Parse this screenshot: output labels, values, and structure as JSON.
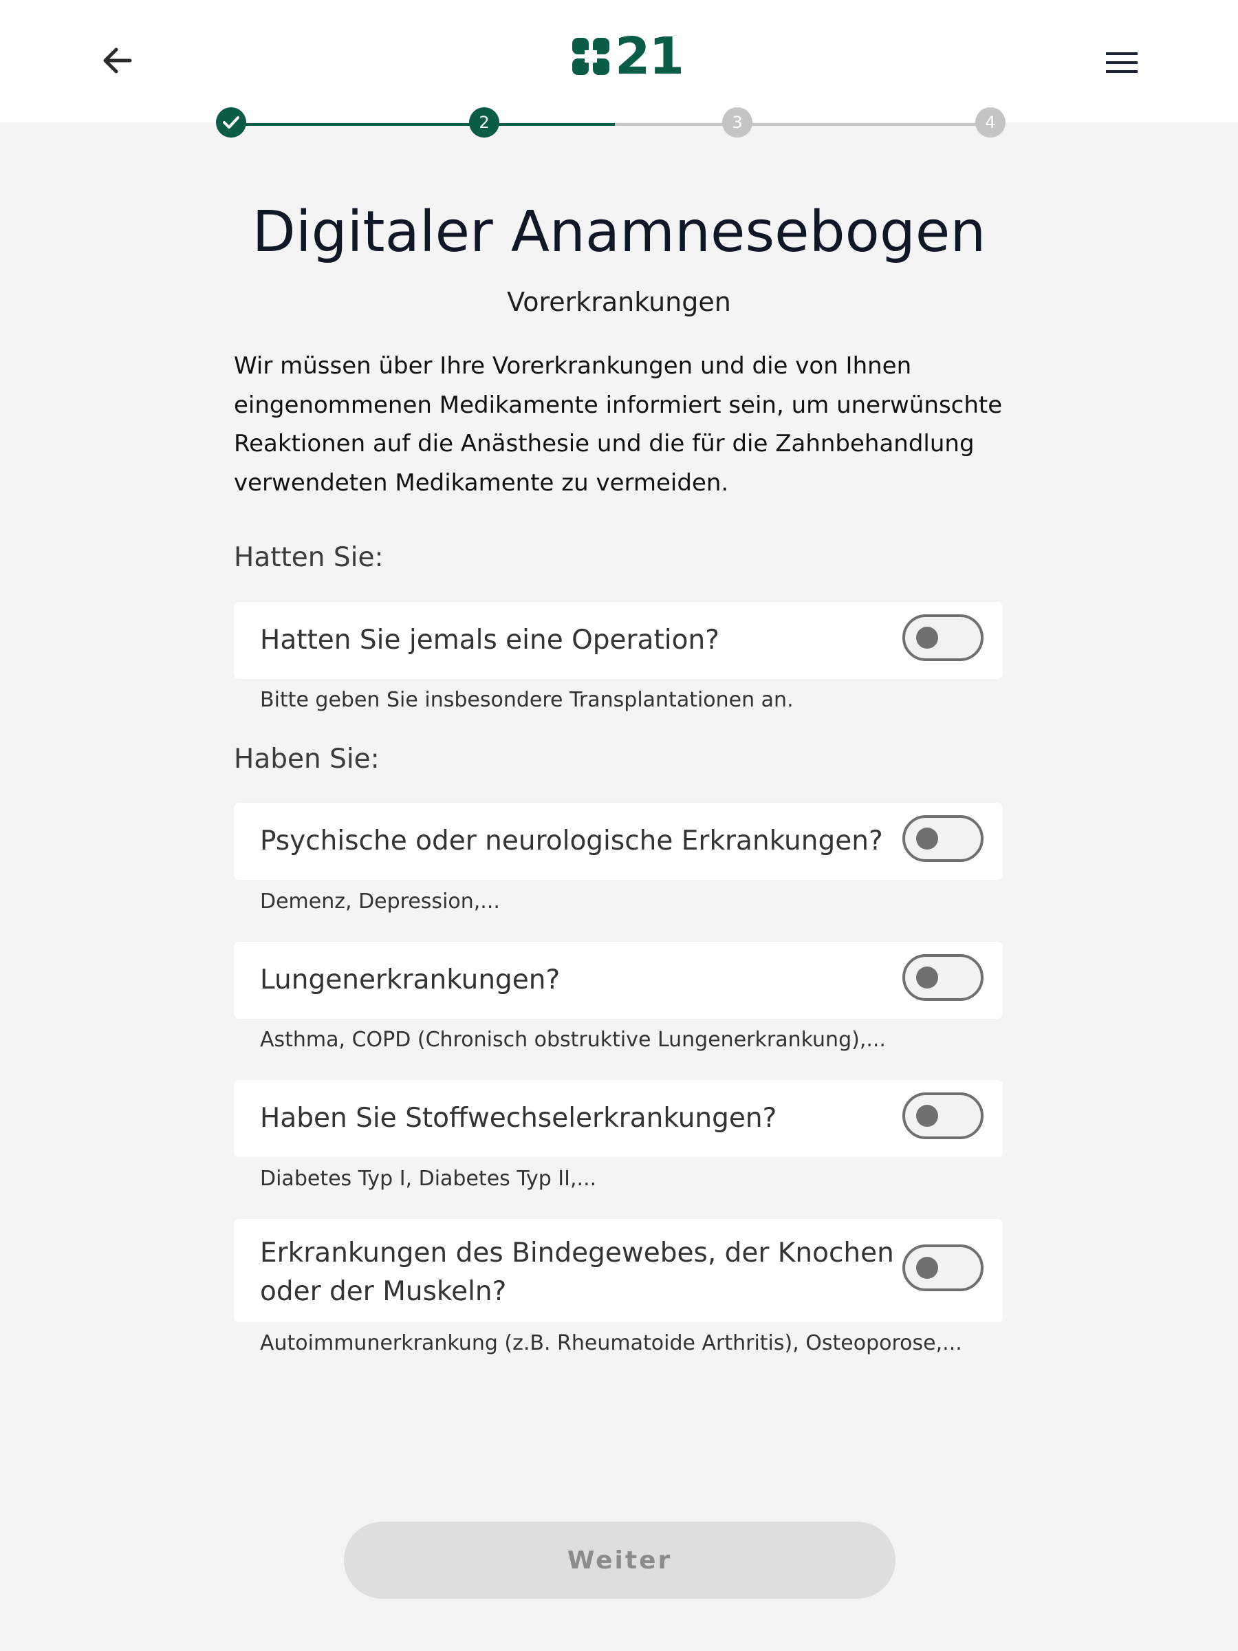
{
  "header": {
    "back_icon": "arrow-left-icon",
    "logo_text": "21",
    "logo_icon": "clover-dots-icon",
    "menu_icon": "hamburger-menu-icon",
    "brand_color": "#0b5c46"
  },
  "stepper": {
    "steps": [
      {
        "label": "",
        "state": "done"
      },
      {
        "label": "2",
        "state": "current"
      },
      {
        "label": "3",
        "state": "todo"
      },
      {
        "label": "4",
        "state": "todo"
      }
    ]
  },
  "main": {
    "title": "Digitaler Anamnesebogen",
    "subtitle": "Vorerkrankungen",
    "intro_lines": [
      "Wir müssen über Ihre Vorerkrankungen und die von Ihnen",
      "eingenommenen Medikamente informiert sein, um unerwünschte",
      "Reaktionen auf die Anästhesie und die für die Zahnbehandlung",
      "verwendeten Medikamente zu vermeiden."
    ],
    "section_had": "Hatten Sie:",
    "section_have": "Haben Sie:",
    "questions": [
      {
        "label": "Hatten Sie jemals eine Operation?",
        "hint": "Bitte geben Sie insbesondere Transplantationen an.",
        "checked": false
      },
      {
        "label": "Psychische oder neurologische Erkrankungen?",
        "hint": "Demenz, Depression,...",
        "checked": false
      },
      {
        "label": "Lungenerkrankungen?",
        "hint": "Asthma, COPD (Chronisch obstruktive Lungenerkrankung),...",
        "checked": false
      },
      {
        "label": "Haben Sie Stoffwechselerkrankungen?",
        "hint": "Diabetes Typ I, Diabetes Typ II,...",
        "checked": false
      },
      {
        "label_lines": [
          "Erkrankungen des Bindegewebes, der Knochen",
          "oder der Muskeln?"
        ],
        "hint": "Autoimmunerkrankung (z.B. Rheumatoide Arthritis), Osteoporose,...",
        "checked": false
      }
    ],
    "next_button": "Weiter"
  }
}
